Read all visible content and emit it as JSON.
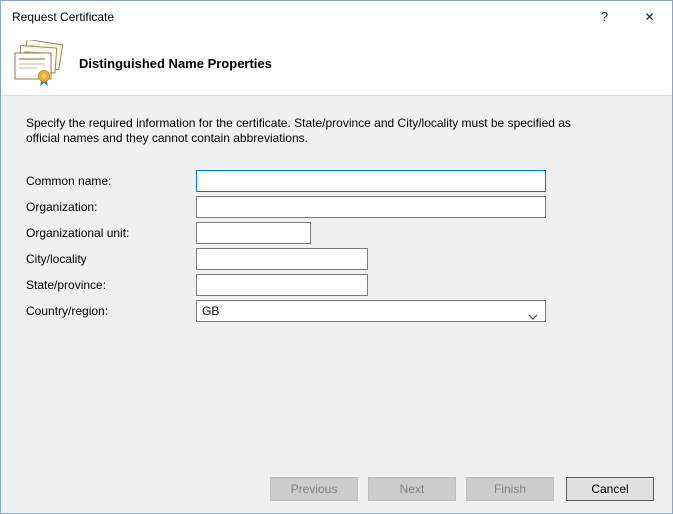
{
  "window": {
    "title": "Request Certificate",
    "help_glyph": "?",
    "close_glyph": "✕"
  },
  "header": {
    "title": "Distinguished Name Properties"
  },
  "instructions": "Specify the required information for the certificate. State/province and City/locality must be specified as official names and they cannot contain abbreviations.",
  "form": {
    "fields": [
      {
        "label": "Common name:",
        "value": ""
      },
      {
        "label": "Organization:",
        "value": ""
      },
      {
        "label": "Organizational unit:",
        "value": ""
      },
      {
        "label": "City/locality",
        "value": ""
      },
      {
        "label": "State/province:",
        "value": ""
      },
      {
        "label": "Country/region:",
        "value": "GB"
      }
    ]
  },
  "buttons": {
    "previous": "Previous",
    "next": "Next",
    "finish": "Finish",
    "cancel": "Cancel"
  },
  "colors": {
    "focus_border": "#0078d7",
    "seal_gold": "#f2b32a"
  }
}
